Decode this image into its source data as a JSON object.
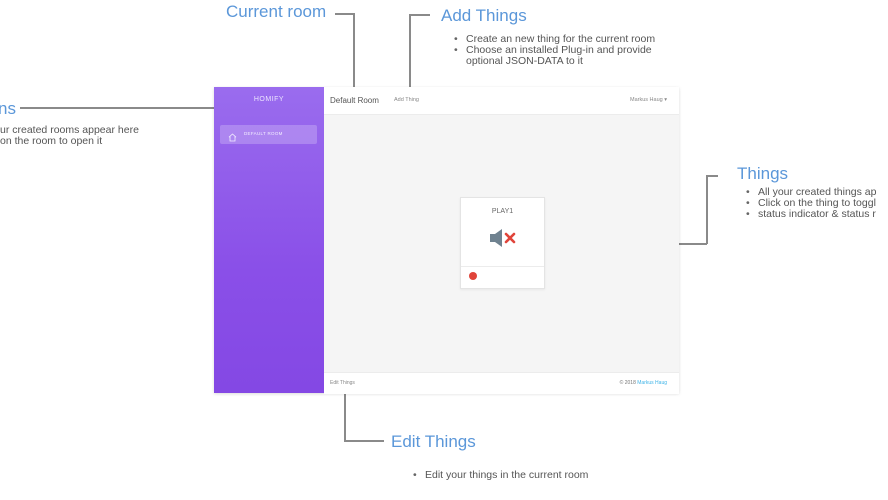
{
  "annotations": {
    "current_room": {
      "title": "Current room"
    },
    "add_things": {
      "title": "Add Things",
      "bullets": [
        "Create an new thing for the current room",
        "Choose an installed Plug-in and provide",
        "optional JSON-DATA to it"
      ]
    },
    "rooms": {
      "title": "ns",
      "lines": [
        "ur created rooms appear here",
        "on the room to open it"
      ]
    },
    "things": {
      "title": "Things",
      "bullets": [
        "All your created things ap",
        "Click on the thing to toggl",
        "status indicator & status r"
      ]
    },
    "edit_things": {
      "title": "Edit Things",
      "bullets": [
        "Edit your things in the current room"
      ]
    }
  },
  "app": {
    "brand": "HOMIFY",
    "sidebar": {
      "items": [
        {
          "label": "DEFAULT ROOM",
          "icon": "home-icon"
        }
      ]
    },
    "topbar": {
      "room_title": "Default Room",
      "add_thing": "Add Thing",
      "user": "Markus Haug"
    },
    "thing": {
      "name": "PLAY1",
      "icon": "speaker-muted-icon",
      "status_color": "#e0443a"
    },
    "footer": {
      "edit_things": "Edit Things",
      "copyright_prefix": "© 2018",
      "copyright_name": "Markus Haug"
    }
  }
}
